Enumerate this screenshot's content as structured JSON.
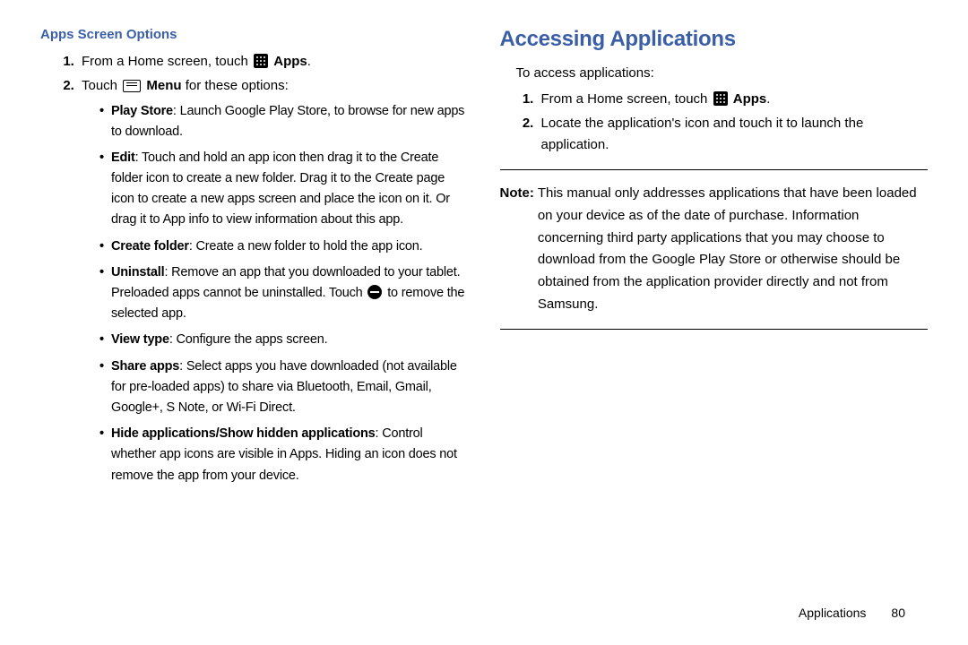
{
  "left": {
    "header": "Apps Screen Options",
    "step1_a": "From a Home screen, touch ",
    "step1_b": "Apps",
    "step1_c": ".",
    "step2_a": "Touch ",
    "step2_b": "Menu",
    "step2_c": " for these options:",
    "options": [
      {
        "title": "Play Store",
        "desc": ": Launch Google Play Store, to browse for new apps to download."
      },
      {
        "title": "Edit",
        "desc": ": Touch and hold an app icon then drag it to the Create folder icon to create a new folder. Drag it to the Create page icon to create a new apps screen and place the icon on it. Or drag it to App info to view information about this app."
      },
      {
        "title": "Create folder",
        "desc": ": Create a new folder to hold the app icon."
      },
      {
        "title": "Uninstall",
        "desc_a": ": Remove an app that you downloaded to your tablet. Preloaded apps cannot be uninstalled. Touch ",
        "desc_b": " to remove the selected app."
      },
      {
        "title": "View type",
        "desc": ": Configure the apps screen."
      },
      {
        "title": "Share apps",
        "desc": ": Select apps you have downloaded (not available for pre-loaded apps) to share via Bluetooth, Email, Gmail, Google+, S Note, or Wi-Fi Direct."
      },
      {
        "title": "Hide applications/Show hidden applications",
        "desc": ": Control whether app icons are visible in Apps. Hiding an icon does not remove the app from your device."
      }
    ]
  },
  "right": {
    "header": "Accessing Applications",
    "intro": "To access applications:",
    "step1_a": "From a Home screen, touch ",
    "step1_b": "Apps",
    "step1_c": ".",
    "step2": "Locate the application's icon and touch it to launch the application.",
    "note_label": "Note:",
    "note_body": "This manual only addresses applications that have been loaded on your device as of the date of purchase. Information concerning third party applications that you may choose to download from the Google Play Store or otherwise should be obtained from the application provider directly and not from Samsung."
  },
  "footer": {
    "section": "Applications",
    "page": "80"
  }
}
